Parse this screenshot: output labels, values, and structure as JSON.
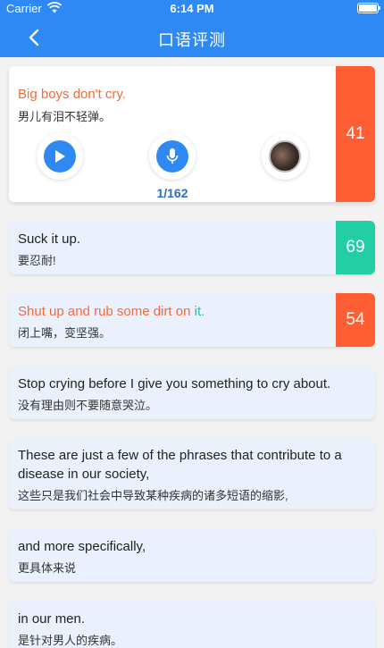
{
  "status": {
    "carrier": "Carrier",
    "time": "6:14 PM"
  },
  "nav": {
    "title": "口语评测"
  },
  "active": {
    "en": "Big boys don't cry.",
    "zh": "男儿有泪不轻弹。",
    "score": "41",
    "counter": "1/162"
  },
  "sentences": [
    {
      "en": "Suck it up.",
      "zh": "要忍耐!",
      "score": "69"
    },
    {
      "en_main": "Shut up and rub some dirt on ",
      "en_hl": "it.",
      "zh": "闭上嘴，变坚强。",
      "score": "54"
    },
    {
      "en": "Stop crying before I give you something to cry about.",
      "zh": "没有理由则不要随意哭泣。"
    },
    {
      "en_line1": "These are just a few of the phrases that contribute to a",
      "en_line2": "disease in our society,",
      "zh": "这些只是我们社会中导致某种疾病的诸多短语的缩影,"
    },
    {
      "en": "and more specifically,",
      "zh": "更具体来说"
    },
    {
      "en": "in our men.",
      "zh": "是针对男人的疾病。"
    }
  ],
  "colors": {
    "brand": "#2f89f5",
    "low": "#ff5e35",
    "good": "#22cfa5",
    "highlight_red": "#f36b3a"
  },
  "icons": {
    "back": "chevron-left-icon",
    "play": "play-icon",
    "record": "microphone-icon",
    "playback": "recording-thumbnail"
  }
}
